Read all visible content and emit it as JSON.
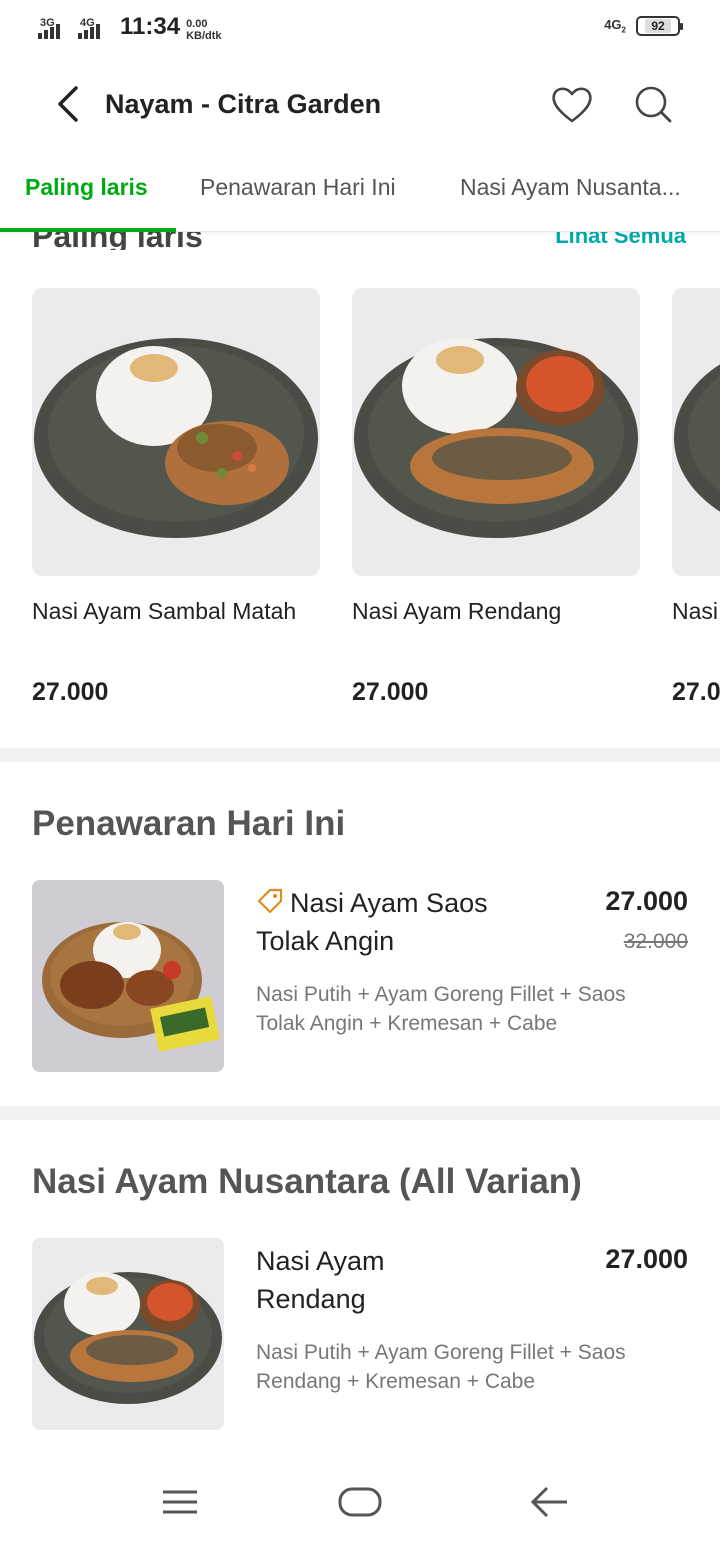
{
  "status_bar": {
    "network_1": "3G",
    "network_2": "4G",
    "time": "11:34",
    "speed_value": "0.00",
    "speed_unit": "KB/dtk",
    "network_right": "4G",
    "network_right_sub": "2",
    "battery": "92"
  },
  "header": {
    "title": "Nayam - Citra Garden"
  },
  "tabs": [
    {
      "label": "Paling laris",
      "active": true
    },
    {
      "label": "Penawaran Hari Ini",
      "active": false
    },
    {
      "label": "Nasi Ayam Nusanta...",
      "active": false
    }
  ],
  "best_sellers": {
    "title": "Paling laris",
    "see_all": "Lihat Semua",
    "items": [
      {
        "name": "Nasi Ayam Sambal Matah",
        "price": "27.000"
      },
      {
        "name": "Nasi Ayam Rendang",
        "price": "27.000"
      },
      {
        "name": "Nasi",
        "price": "27.0"
      }
    ]
  },
  "deals": {
    "title": "Penawaran Hari Ini",
    "item": {
      "name": "Nasi Ayam Saos Tolak Angin",
      "price": "27.000",
      "old_price": "32.000",
      "description": "Nasi Putih + Ayam Goreng Fillet + Saos Tolak Angin + Kremesan + Cabe"
    }
  },
  "nusantara": {
    "title": "Nasi Ayam Nusantara (All Varian)",
    "item": {
      "name": "Nasi Ayam Rendang",
      "price": "27.000",
      "description": "Nasi Putih + Ayam Goreng Fillet + Saos Rendang + Kremesan + Cabe"
    }
  },
  "colors": {
    "accent": "#00aa13",
    "link": "#00aaaa",
    "plate": "#4a4d45"
  },
  "icons": {
    "back": "chevron-left-icon",
    "favorite": "heart-icon",
    "search": "search-icon",
    "promo": "tag-icon",
    "nav_menu": "menu-icon",
    "nav_home": "home-icon",
    "nav_back": "arrow-left-icon"
  }
}
